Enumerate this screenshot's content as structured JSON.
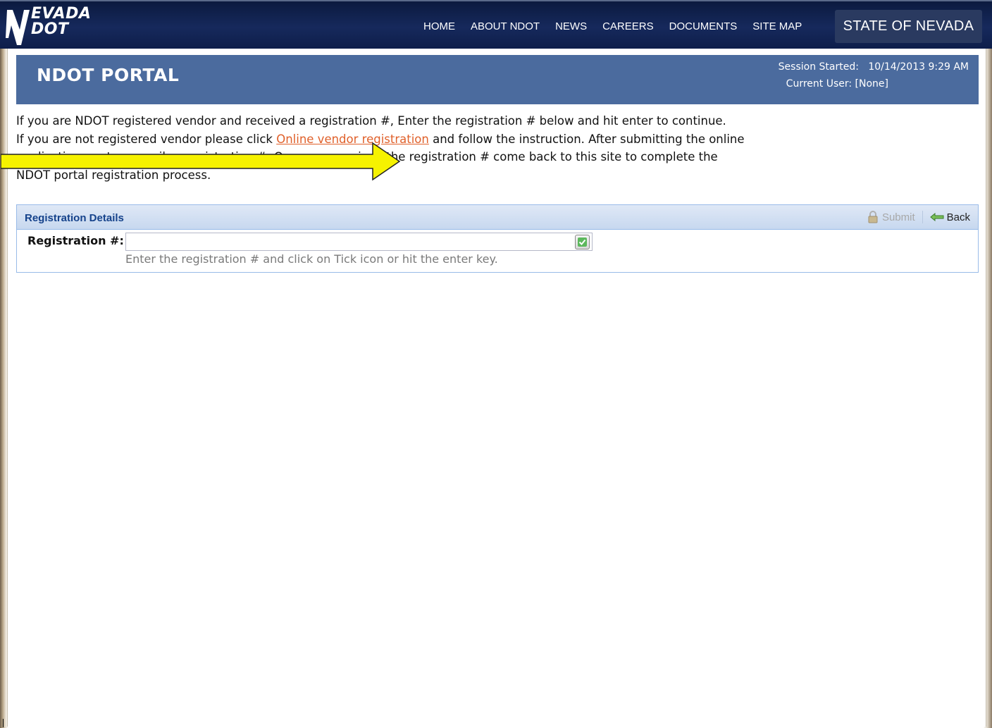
{
  "header": {
    "logo": {
      "line1": "EVADA",
      "line2": "DOT",
      "glyph": "N"
    },
    "nav": [
      "HOME",
      "ABOUT NDOT",
      "NEWS",
      "CAREERS",
      "DOCUMENTS",
      "SITE MAP"
    ],
    "state_label": "STATE OF NEVADA"
  },
  "portal": {
    "title": "NDOT PORTAL",
    "session_label": "Session Started:",
    "session_value": "10/14/2013 9:29 AM",
    "user_label": "Current User:",
    "user_value": "[None]"
  },
  "intro": {
    "para1": "If you are NDOT registered vendor and received a registration #, Enter the registration # below and hit enter to continue.",
    "para2_start": "If you are not registered vendor please click",
    "link_text": "Online vendor registration",
    "para2_end": " and follow the instruction. After submitting the online application, system emails a registration #. Once you received the registration # come back to this site to complete the NDOT portal registration process."
  },
  "registration": {
    "panel_title": "Registration Details",
    "submit_label": "Submit",
    "back_label": "Back",
    "field_label": "Registration #:",
    "field_value": "",
    "hint": "Enter the registration # and click on Tick icon or hit the enter key."
  },
  "icons": {
    "submit": "lock-icon",
    "back": "back-arrow-icon",
    "tick": "checkmark-icon",
    "annotation": "yellow-arrow-icon"
  },
  "colors": {
    "nav_bg": "#16295c",
    "portal_header": "#4b6b9e",
    "link": "#e0602a",
    "panel_title": "#15428b",
    "arrow": "#f6f200"
  }
}
